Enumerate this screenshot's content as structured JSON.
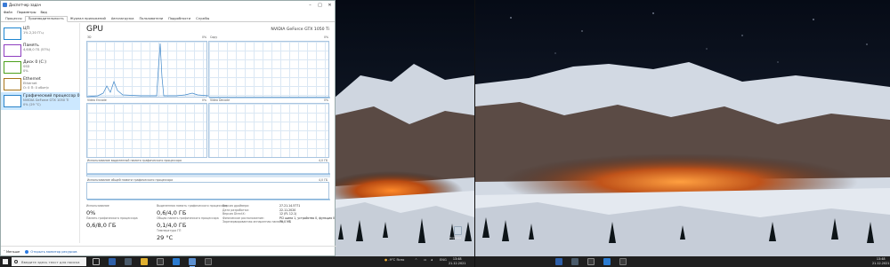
{
  "task_manager": {
    "window_title": "Диспетчер задач",
    "menu": [
      "Файл",
      "Параметры",
      "Вид"
    ],
    "tabs": [
      "Процессы",
      "Производительность",
      "Журнал приложений",
      "Автозагрузка",
      "Пользователи",
      "Подробности",
      "Службы"
    ],
    "active_tab": "Производительность",
    "sidebar": [
      {
        "title": "ЦП",
        "line1": "1% 2,20 ГГц",
        "line2": "",
        "color": "#1d86d1"
      },
      {
        "title": "Память",
        "line1": "4,6/8,0 ГБ (57%)",
        "line2": "",
        "color": "#8e3fc0"
      },
      {
        "title": "Диск 0 (C:)",
        "line1": "SSD",
        "line2": "0%",
        "color": "#4ca01c"
      },
      {
        "title": "Ethernet",
        "line1": "Ethernet",
        "line2": "О: 0 П: 0 кбит/с",
        "color": "#a8751a"
      },
      {
        "title": "Графический процессор 0",
        "line1": "NVIDIA GeForce GTX 1050 Ti",
        "line2": "0% (29 °C)",
        "color": "#2a83c9"
      }
    ],
    "gpu": {
      "heading": "GPU",
      "model": "NVIDIA GeForce GTX 1050 Ti",
      "engines": [
        {
          "name": "3D",
          "value": "0%"
        },
        {
          "name": "Copy",
          "value": "0%"
        },
        {
          "name": "Video Encode",
          "value": "0%"
        },
        {
          "name": "Video Decode",
          "value": "0%"
        }
      ],
      "dedicated_label": "Использование выделенной памяти графического процессора",
      "dedicated_max": "4,0 ГБ",
      "shared_label": "Использование общей памяти графического процессора",
      "shared_max": "4,0 ГБ",
      "stats": [
        {
          "label": "Использование",
          "value": "0%"
        },
        {
          "label": "Выделенная память графического процессора",
          "value": "0,6/4,0 ГБ"
        },
        {
          "label": "Память графического процессора",
          "value": "0,6/8,0 ГБ"
        },
        {
          "label": "Общая память графического процессора",
          "value": "0,1/4,0 ГБ"
        },
        {
          "label": "Температура ГП",
          "value": "29 °C"
        }
      ],
      "details_labels": [
        "Версия драйвера:",
        "Дата разработки:",
        "Версия DirectX:",
        "Физическое расположение:",
        "Зарезервированная аппаратная память:"
      ],
      "details_values": [
        "27.21.14.5771",
        "22.11.2020",
        "12 (FL 12.1)",
        "PCI шина 1, устройство 0, функция 0",
        "79,0 МБ"
      ]
    },
    "footer": {
      "less": "Меньше",
      "monitor_link": "Открыть монитор ресурсов"
    }
  },
  "taskbar": {
    "search_placeholder": "Введите здесь текст для поиска",
    "temperature": "-9°C",
    "weather": "Ясно",
    "language": "ENG",
    "time": "13:48",
    "date": "21.12.2021",
    "time_right": "13:48",
    "date_right": "21.12.2021"
  },
  "desktop": {
    "recycle_bin_label": "Корзина"
  }
}
